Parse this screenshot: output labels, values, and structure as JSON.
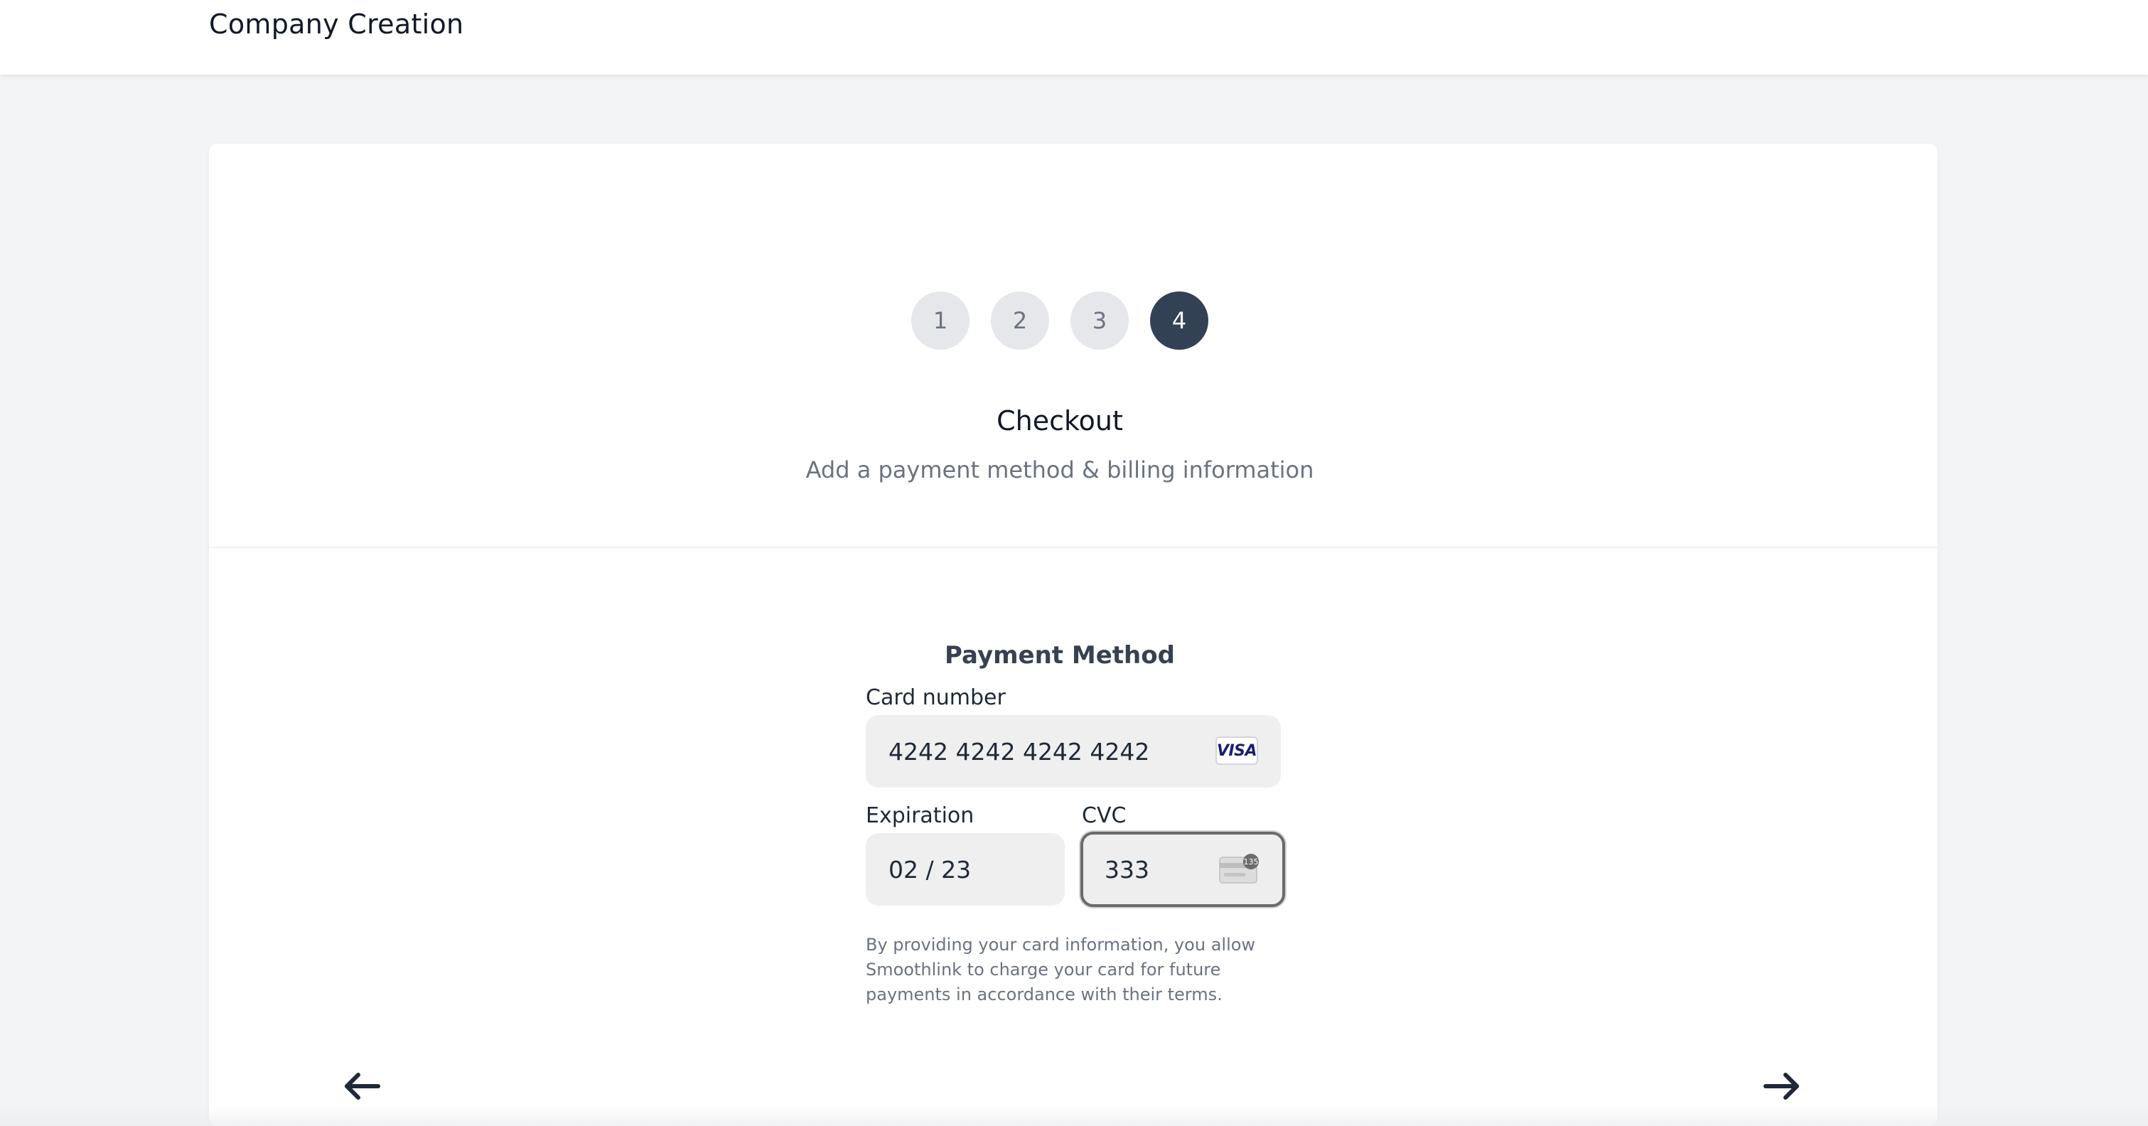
{
  "header": {
    "title": "Company Creation"
  },
  "stepper": {
    "steps": [
      "1",
      "2",
      "3",
      "4"
    ],
    "active_step": 4
  },
  "step_info": {
    "title": "Checkout",
    "subtitle": "Add a payment method & billing information"
  },
  "payment": {
    "heading": "Payment Method",
    "card_number_label": "Card number",
    "card_number_value": "4242 4242 4242 4242",
    "card_brand": "VISA",
    "expiration_label": "Expiration",
    "expiration_value": "02 / 23",
    "cvc_label": "CVC",
    "cvc_value": "333",
    "cvc_icon_text": "135",
    "disclaimer": "By providing your card information, you allow Smoothlink to charge your card for future payments in accordance with their terms."
  },
  "nav": {
    "back_icon": "arrow-left-icon",
    "next_icon": "arrow-right-icon"
  },
  "colors": {
    "active_step": "#334155",
    "inactive_step": "#e5e7eb",
    "background": "#f3f4f6",
    "card": "#ffffff"
  }
}
